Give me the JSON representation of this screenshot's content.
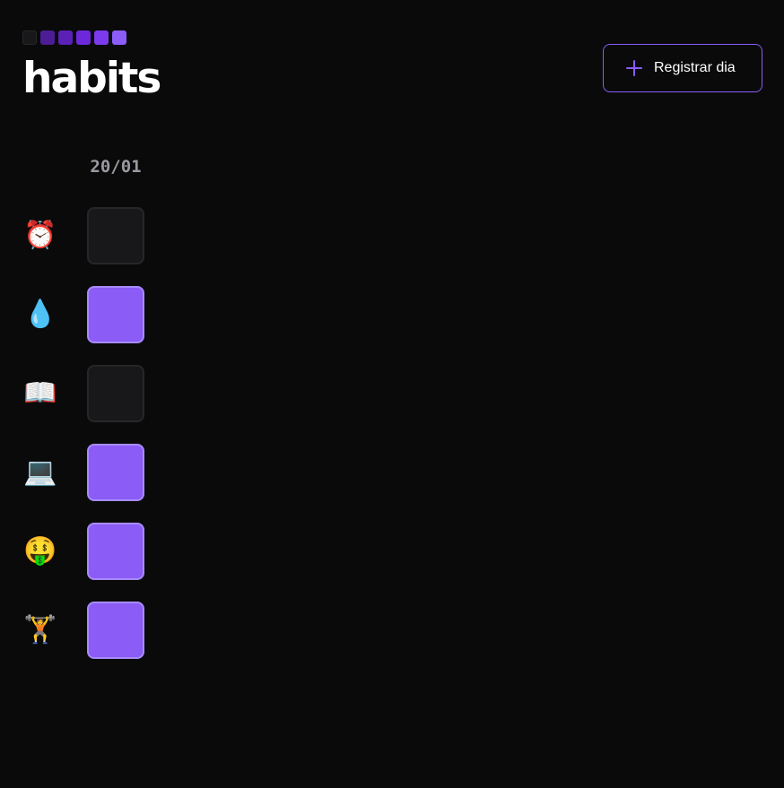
{
  "brand": {
    "title": "habits",
    "logo_colors": [
      "#18181b",
      "#4c1d95",
      "#5b21b6",
      "#6d28d9",
      "#7c3aed",
      "#8b5cf6"
    ]
  },
  "header": {
    "register_button_label": "Registrar dia",
    "register_button_icon": "plus-icon"
  },
  "colors": {
    "accent": "#8b5cf6",
    "cell_done": "#8b5cf6",
    "cell_done_border": "#a78bfa",
    "cell_empty": "#18181b",
    "cell_empty_border": "#27272a",
    "background": "#0a0a0a"
  },
  "dates": [
    "20/01"
  ],
  "habits": [
    {
      "emoji": "⏰",
      "icon": "alarm-clock-icon",
      "name": "alarm",
      "done": [
        false
      ]
    },
    {
      "emoji": "💧",
      "icon": "water-drop-icon",
      "name": "water",
      "done": [
        true
      ]
    },
    {
      "emoji": "📖",
      "icon": "open-book-icon",
      "name": "read",
      "done": [
        false
      ]
    },
    {
      "emoji": "💻",
      "icon": "laptop-icon",
      "name": "code",
      "done": [
        true
      ]
    },
    {
      "emoji": "🤑",
      "icon": "money-face-icon",
      "name": "money",
      "done": [
        true
      ]
    },
    {
      "emoji": "🏋️",
      "icon": "weightlifter-icon",
      "name": "workout",
      "done": [
        true
      ]
    }
  ]
}
